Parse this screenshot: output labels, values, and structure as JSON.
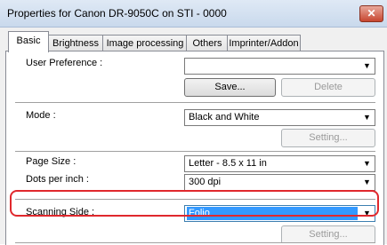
{
  "window": {
    "title": "Properties for Canon DR-9050C on STI - 0000",
    "close_glyph": "✕"
  },
  "tabs": [
    {
      "label": "Basic"
    },
    {
      "label": "Brightness"
    },
    {
      "label": "Image processing"
    },
    {
      "label": "Others"
    },
    {
      "label": "Imprinter/Addon"
    }
  ],
  "basic": {
    "user_preference": {
      "label": "User Preference :",
      "value": ""
    },
    "save_label": "Save...",
    "delete_label": "Delete",
    "mode": {
      "label": "Mode :",
      "value": "Black and White"
    },
    "mode_setting_label": "Setting...",
    "page_size": {
      "label": "Page Size :",
      "value": "Letter - 8.5 x 11 in"
    },
    "dpi": {
      "label": "Dots per inch :",
      "value": "300 dpi"
    },
    "scanning_side": {
      "label": "Scanning Side :",
      "value": "Folio"
    },
    "side_setting_label": "Setting..."
  },
  "colors": {
    "highlight": "#e0282d",
    "selection": "#3399ff"
  }
}
